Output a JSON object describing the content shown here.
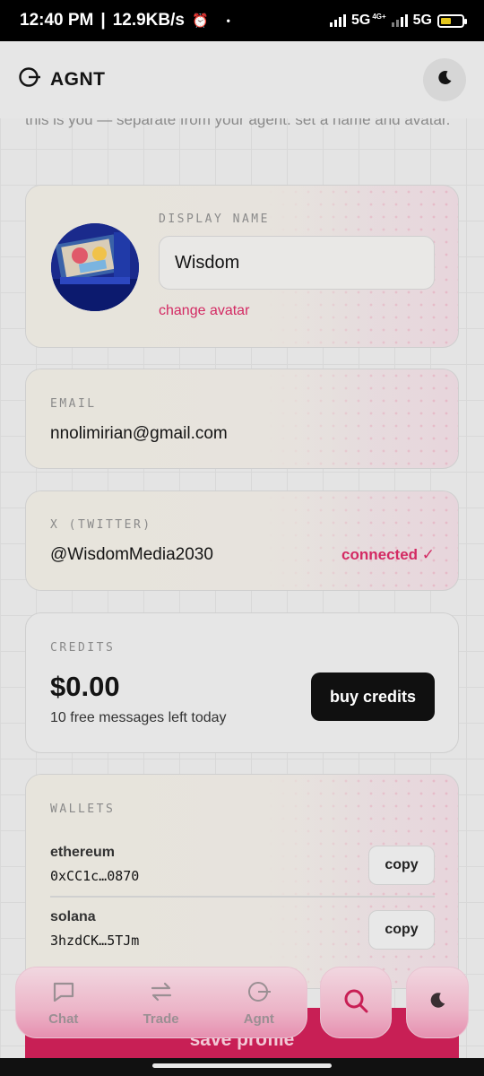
{
  "status_bar": {
    "time": "12:40 PM",
    "separator": "|",
    "speed": "12.9KB/s",
    "dot": "•",
    "network1": "5G",
    "network1_sub": "4G+",
    "network2": "5G",
    "battery_level": 0.5,
    "battery_color": "#e3c51d"
  },
  "header": {
    "brand": "AGNT",
    "logo_icon": "agnt-logo-icon",
    "theme_icon": "moon-icon"
  },
  "intro_text": "this is you — separate from your agent. set a name and avatar.",
  "profile": {
    "display_name_label": "DISPLAY NAME",
    "display_name_value": "Wisdom",
    "change_avatar": "change avatar"
  },
  "email": {
    "label": "EMAIL",
    "value": "nnolimirian@gmail.com"
  },
  "twitter": {
    "label": "X (TWITTER)",
    "handle": "@WisdomMedia2030",
    "status": "connected ✓"
  },
  "credits": {
    "label": "CREDITS",
    "amount": "$0.00",
    "subtext": "10 free messages left today",
    "buy_label": "buy credits"
  },
  "wallets": {
    "label": "WALLETS",
    "items": [
      {
        "chain": "ethereum",
        "address": "0xCC1c…0870",
        "copy_label": "copy"
      },
      {
        "chain": "solana",
        "address": "3hzdCK…5TJm",
        "copy_label": "copy"
      }
    ]
  },
  "save_label": "save profile",
  "nav": {
    "items": [
      {
        "label": "Chat",
        "icon": "chat-icon"
      },
      {
        "label": "Trade",
        "icon": "swap-icon"
      },
      {
        "label": "Agnt",
        "icon": "agnt-logo-icon"
      }
    ],
    "search_icon": "search-icon",
    "theme_icon": "moon-icon"
  },
  "colors": {
    "accent": "#d32a63",
    "save_button": "#c81f55",
    "dark_button": "#101010"
  }
}
